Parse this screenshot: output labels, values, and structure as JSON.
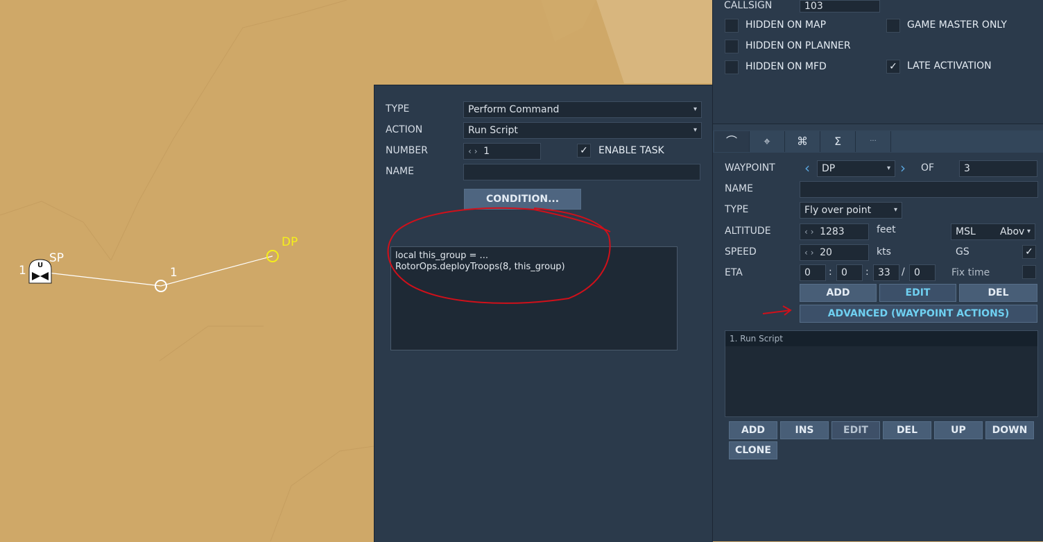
{
  "map": {
    "markers": [
      {
        "label": "SP"
      },
      {
        "label": "1"
      },
      {
        "label": "DP"
      }
    ],
    "group_number": "1",
    "unit_icon_letter": "U"
  },
  "action_panel": {
    "type_label": "TYPE",
    "type_value": "Perform Command",
    "action_label": "ACTION",
    "action_value": "Run Script",
    "number_label": "NUMBER",
    "number_value": "1",
    "enable_task_label": "ENABLE TASK",
    "enable_task_checked": true,
    "name_label": "NAME",
    "name_value": "",
    "condition_button": "CONDITION...",
    "script_lines": [
      "local this_group = ...",
      "RotorOps.deployTroops(8, this_group)"
    ]
  },
  "group_panel": {
    "callsign_label": "CALLSIGN",
    "callsign_value": "103",
    "hidden_on_map": "HIDDEN ON MAP",
    "hidden_on_planner": "HIDDEN ON PLANNER",
    "hidden_on_mfd": "HIDDEN ON MFD",
    "game_master_only": "GAME MASTER ONLY",
    "late_activation": "LATE ACTIVATION",
    "late_activation_checked": true
  },
  "tabs": [
    {
      "icon": "waypoint-path-icon",
      "glyph": "⌒"
    },
    {
      "icon": "target-icon",
      "glyph": "⌖"
    },
    {
      "icon": "payload-icon",
      "glyph": "⌘"
    },
    {
      "icon": "summary-icon",
      "glyph": "Σ"
    },
    {
      "icon": "more-icon",
      "glyph": "···"
    }
  ],
  "waypoint": {
    "waypoint_label": "WAYPOINT",
    "waypoint_value": "DP",
    "of_label": "OF",
    "of_value": "3",
    "name_label": "NAME",
    "name_value": "",
    "type_label": "TYPE",
    "type_value": "Fly over point",
    "altitude_label": "ALTITUDE",
    "altitude_value": "1283",
    "altitude_unit": "feet",
    "altitude_ref": "MSL",
    "altitude_ref2": "Abov",
    "speed_label": "SPEED",
    "speed_value": "20",
    "speed_unit": "kts",
    "gs_label": "GS",
    "gs_checked": true,
    "eta_label": "ETA",
    "eta_d": "0",
    "eta_h": "0",
    "eta_m": "33",
    "eta_s": "0",
    "fix_time_label": "Fix time",
    "add_button": "ADD",
    "edit_button": "EDIT",
    "del_button": "DEL",
    "advanced_button": "ADVANCED (WAYPOINT ACTIONS)"
  },
  "actions_list": {
    "items": [
      "1. Run Script"
    ],
    "buttons": [
      "ADD",
      "INS",
      "EDIT",
      "DEL",
      "UP",
      "DOWN"
    ],
    "clone_button": "CLONE"
  },
  "colors": {
    "map_sand": "#cfa868",
    "panel": "#2b3a4b",
    "accent": "#6fd0f1",
    "annotation_red": "#d0101a",
    "waypoint_selected": "#f5ef1a"
  }
}
